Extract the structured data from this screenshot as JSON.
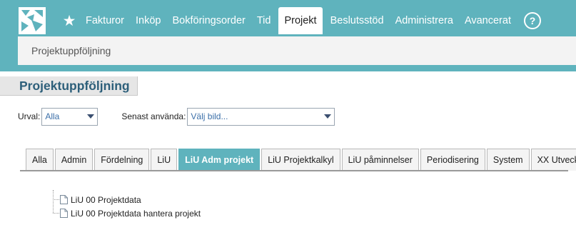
{
  "app": {
    "accent": "#5fb3bd",
    "title_color": "#2d5f7a"
  },
  "nav": {
    "favorites_icon": "star-icon",
    "items": [
      {
        "label": "Fakturor",
        "active": false
      },
      {
        "label": "Inköp",
        "active": false
      },
      {
        "label": "Bokföringsorder",
        "active": false
      },
      {
        "label": "Tid",
        "active": false
      },
      {
        "label": "Projekt",
        "active": true
      },
      {
        "label": "Beslutsstöd",
        "active": false
      },
      {
        "label": "Administrera",
        "active": false
      },
      {
        "label": "Avancerat",
        "active": false
      }
    ],
    "help_label": "?"
  },
  "breadcrumb": {
    "label": "Projektuppföljning"
  },
  "page": {
    "title": "Projektuppföljning"
  },
  "filters": {
    "urval_label": "Urval:",
    "urval_value": "Alla",
    "senast_label": "Senast använda:",
    "senast_value": "Välj bild..."
  },
  "tabs": [
    {
      "label": "Alla",
      "active": false
    },
    {
      "label": "Admin",
      "active": false
    },
    {
      "label": "Fördelning",
      "active": false
    },
    {
      "label": "LiU",
      "active": false
    },
    {
      "label": "LiU Adm projekt",
      "active": true
    },
    {
      "label": "LiU Projektkalkyl",
      "active": false
    },
    {
      "label": "LiU påminnelser",
      "active": false
    },
    {
      "label": "Periodisering",
      "active": false
    },
    {
      "label": "System",
      "active": false
    },
    {
      "label": "XX Utveckling",
      "active": false
    }
  ],
  "tree": [
    {
      "label": "LiU 00 Projektdata",
      "icon": "document-icon"
    },
    {
      "label": "LiU 00 Projektdata hantera projekt",
      "icon": "document-icon"
    }
  ]
}
